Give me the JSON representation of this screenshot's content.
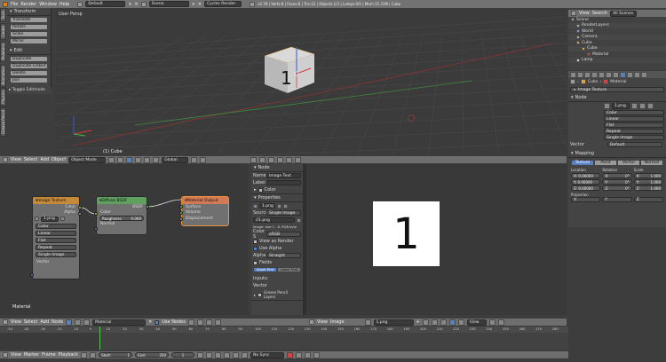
{
  "topbar": {
    "menus": [
      "File",
      "Render",
      "Window",
      "Help"
    ],
    "layout": "Default",
    "scene": "Scene",
    "engine": "Cycles Render",
    "stats": "v2.79 | Verts:8 | Faces:6 | Tris:12 | Objects:1/3 | Lamps:0/1 | Mem:15.31M | Cube"
  },
  "toolshelf": {
    "tabs": [
      "Tools",
      "Create",
      "Relations",
      "Animation",
      "Physics",
      "Grease Pencil"
    ],
    "transform_header": "Transform",
    "transform_buttons": [
      "Translate",
      "Rotate",
      "Scale",
      "Mirror"
    ],
    "edit_header": "Edit",
    "edit_buttons": [
      "Duplicate",
      "Duplicate Linked",
      "Delete",
      "Join"
    ],
    "toggle_label": "Toggle Editmode"
  },
  "viewport": {
    "label": "User Persp",
    "object_label": "(1) Cube",
    "cube_text": "1",
    "header": {
      "view": "View",
      "select": "Select",
      "add": "Add",
      "object": "Object",
      "mode": "Object Mode",
      "orientation": "Global"
    }
  },
  "outliner": {
    "header": {
      "view": "View",
      "search": "Search",
      "filter": "All Scenes"
    },
    "items": [
      {
        "label": "Scene",
        "depth": 0
      },
      {
        "label": "RenderLayers",
        "depth": 1
      },
      {
        "label": "World",
        "depth": 1
      },
      {
        "label": "Camera",
        "depth": 1
      },
      {
        "label": "Cube",
        "depth": 1
      },
      {
        "label": "Cube",
        "depth": 2
      },
      {
        "label": "Material",
        "depth": 3
      },
      {
        "label": "Lamp",
        "depth": 1
      }
    ]
  },
  "properties": {
    "breadcrumb_object": "Cube",
    "breadcrumb_material": "Material",
    "node_title": "Image Texture",
    "node_section": "Node",
    "image_name": "1.png",
    "fields": [
      "Color",
      "Linear",
      "Flat",
      "Repeat",
      "Single Image"
    ],
    "vector_label": "Vector",
    "vector_value": "Default",
    "mapping_section": "Mapping",
    "mapping_tabs": [
      "Texture",
      "Point",
      "Vector",
      "Normal"
    ],
    "location_label": "Location",
    "rotation_label": "Rotation",
    "scale_label": "Scale",
    "loc": [
      "X: 0.00000",
      "Y: 0.00000",
      "Z: 0.00000"
    ],
    "rot": [
      "X:",
      "Y:",
      "Z:"
    ],
    "rot_vals": [
      "0°",
      "0°",
      "0°"
    ],
    "scale": [
      "X:",
      "Y:",
      "Z:"
    ],
    "scale_vals": [
      "1.000",
      "1.000",
      "1.000"
    ],
    "projection_label": "Projection",
    "projection": [
      "X",
      "Y",
      "Z"
    ]
  },
  "node_editor": {
    "material_label": "Material",
    "nodes": {
      "image_texture": {
        "title": "Image Texture",
        "out_color": "Color",
        "out_alpha": "Alpha",
        "image": "1.png",
        "options": [
          "Color",
          "Linear",
          "Flat",
          "Repeat",
          "Single Image"
        ],
        "in_vector": "Vector"
      },
      "diffuse": {
        "title": "Diffuse BSDF",
        "out": "BSDF",
        "color": "Color",
        "roughness_label": "Roughness",
        "roughness_value": "0.000",
        "normal": "Normal"
      },
      "material_output": {
        "title": "Material Output",
        "surface": "Surface",
        "volume": "Volume",
        "displacement": "Displacement"
      }
    },
    "header": {
      "view": "View",
      "select": "Select",
      "add": "Add",
      "node": "Node",
      "material": "Material",
      "use_nodes": "Use Nodes"
    }
  },
  "nprops": {
    "node_section": "Node",
    "name_label": "Name:",
    "name_value": "Image Text",
    "label_label": "Label:",
    "color_section": "Color",
    "properties_section": "Properties",
    "image": "1.png",
    "source_label": "Source:",
    "source_value": "Single Image",
    "filename": "//1.png",
    "info": "Image: size 1 - 8, RGB byte",
    "colorspace_label": "Color S",
    "colorspace_value": "sRGB",
    "view_as_render": "View as Render",
    "use_alpha": "Use Alpha",
    "alpha_label": "Alpha:",
    "alpha_value": "Straight",
    "fields": "Fields",
    "fields_buttons": [
      "Upper First",
      "Lower First"
    ],
    "inputs_label": "Inputs:",
    "vector_label": "Vector",
    "grease_section": "Grease Pencil Layers"
  },
  "image_editor": {
    "big_text": "1",
    "header": {
      "view": "View",
      "image": "Image",
      "image_name": "1.png",
      "view2": "View"
    }
  },
  "timeline": {
    "ticks": [
      "-50",
      "-40",
      "-30",
      "-20",
      "-10",
      "0",
      "10",
      "20",
      "30",
      "40",
      "50",
      "60",
      "70",
      "80",
      "90",
      "100",
      "110",
      "120",
      "130",
      "140",
      "150",
      "160",
      "170",
      "180",
      "190",
      "200",
      "210",
      "220",
      "230",
      "240",
      "250",
      "260",
      "270",
      "280"
    ],
    "header": {
      "view": "View",
      "marker": "Marker",
      "frame": "Frame",
      "playback": "Playback",
      "start_label": "Start:",
      "start": "1",
      "end_label": "End:",
      "end": "250",
      "current": "1",
      "sync": "No Sync"
    }
  },
  "colors": {
    "accent": "#5680c2",
    "node_shader": "#5fa05f",
    "node_output": "#d17a55",
    "node_texture": "#e0a046",
    "socket_yellow": "#c7c729",
    "socket_purple": "#6363c7",
    "socket_green": "#63c763",
    "socket_gray": "#a1a1a1"
  }
}
